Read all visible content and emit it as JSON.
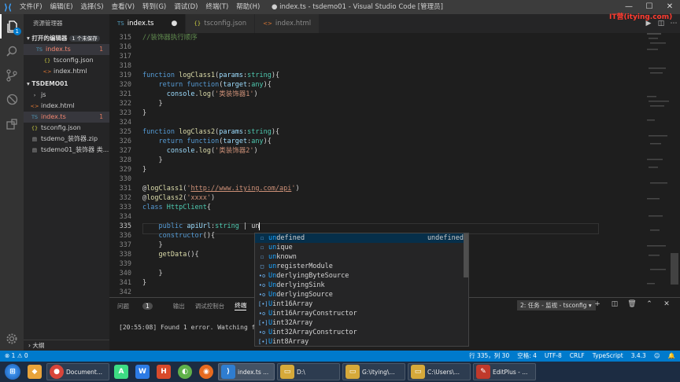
{
  "menu": [
    "文件(F)",
    "编辑(E)",
    "选择(S)",
    "查看(V)",
    "转到(G)",
    "调试(D)",
    "终端(T)",
    "帮助(H)"
  ],
  "window_title": "● index.ts - tsdemo01 - Visual Studio Code [管理员]",
  "watermark": "IT营(itying.com)",
  "sidebar": {
    "title": "资源管理器",
    "open_editors_label": "▾ 打开的编辑器",
    "open_editors_badge": "1 个未保存",
    "open_editors": [
      {
        "name": "index.ts",
        "icon": "TS",
        "modified": "1"
      },
      {
        "name": "tsconfig.json",
        "icon": "{}",
        "modified": ""
      },
      {
        "name": "index.html",
        "icon": "<>",
        "modified": ""
      }
    ],
    "project_label": "▾ TSDEMO01",
    "files": [
      {
        "name": "js",
        "icon": "›",
        "modified": ""
      },
      {
        "name": "index.html",
        "icon": "<>",
        "modified": ""
      },
      {
        "name": "index.ts",
        "icon": "TS",
        "modified": "1"
      },
      {
        "name": "tsconfig.json",
        "icon": "{}",
        "modified": ""
      },
      {
        "name": "tsdemo_装饰器.zip",
        "icon": "▤",
        "modified": ""
      },
      {
        "name": "tsdemo01_装饰器 类...",
        "icon": "▤",
        "modified": ""
      }
    ],
    "outline_label": "› 大纲"
  },
  "tabs": [
    {
      "name": "index.ts",
      "icon": "TS",
      "dirty": "●"
    },
    {
      "name": "tsconfig.json",
      "icon": "{}",
      "dirty": ""
    },
    {
      "name": "index.html",
      "icon": "<>",
      "dirty": ""
    }
  ],
  "editor": {
    "line_numbers": [
      "315",
      "316",
      "317",
      "318",
      "319",
      "320",
      "321",
      "322",
      "323",
      "324",
      "325",
      "326",
      "327",
      "328",
      "329",
      "330",
      "331",
      "332",
      "333",
      "334",
      "335",
      "336",
      "337",
      "338",
      "339",
      "340",
      "341",
      "342"
    ],
    "current_line": "335"
  },
  "suggestions": [
    {
      "label": "undefined",
      "match": "un",
      "rest": "defined",
      "icon": "☐",
      "detail": "undefined"
    },
    {
      "label": "unique",
      "match": "un",
      "rest": "ique",
      "icon": "☐",
      "detail": ""
    },
    {
      "label": "unknown",
      "match": "un",
      "rest": "known",
      "icon": "☐",
      "detail": ""
    },
    {
      "label": "unregisterModule",
      "match": "un",
      "rest": "registerModule",
      "icon": "□",
      "detail": ""
    },
    {
      "label": "UnderlyingByteSource",
      "match": "Un",
      "rest": "derlyingByteSource",
      "icon": "•o",
      "detail": ""
    },
    {
      "label": "UnderlyingSink",
      "match": "Un",
      "rest": "derlyingSink",
      "icon": "•o",
      "detail": ""
    },
    {
      "label": "UnderlyingSource",
      "match": "Un",
      "rest": "derlyingSource",
      "icon": "•o",
      "detail": ""
    },
    {
      "label": "Uint16Array",
      "match": "U",
      "rest": "int16Array",
      "icon": "[•]",
      "detail": ""
    },
    {
      "label": "Uint16ArrayConstructor",
      "match": "U",
      "rest": "int16ArrayConstructor",
      "icon": "•o",
      "detail": ""
    },
    {
      "label": "Uint32Array",
      "match": "U",
      "rest": "int32Array",
      "icon": "[•]",
      "detail": ""
    },
    {
      "label": "Uint32ArrayConstructor",
      "match": "U",
      "rest": "int32ArrayConstructor",
      "icon": "•o",
      "detail": ""
    },
    {
      "label": "Uint8Array",
      "match": "U",
      "rest": "int8Array",
      "icon": "[•]",
      "detail": ""
    }
  ],
  "panel": {
    "tabs": [
      "问题",
      "输出",
      "调试控制台",
      "终端"
    ],
    "problem_count": "1",
    "task_select": "2: 任务 - 监视 - tsconfig ▾",
    "terminal_line": "[20:55:08] Found 1 error. Watching for"
  },
  "statusbar": {
    "left": "⊗ 1 ⚠ 0",
    "position": "行 335，列 30",
    "spaces": "空格: 4",
    "encoding": "UTF-8",
    "eol": "CRLF",
    "language": "TypeScript",
    "version": "3.4.3"
  },
  "taskbar": [
    {
      "label": "Document...",
      "color": "#d8453a"
    },
    {
      "label": "index.ts ...",
      "color": "#2f7dd0"
    },
    {
      "label": "D:\\",
      "color": "#d6a93a"
    },
    {
      "label": "G:\\itying\\...",
      "color": "#d6a93a"
    },
    {
      "label": "C:\\Users\\...",
      "color": "#d6a93a"
    },
    {
      "label": "EditPlus - ...",
      "color": "#c0392b"
    }
  ]
}
